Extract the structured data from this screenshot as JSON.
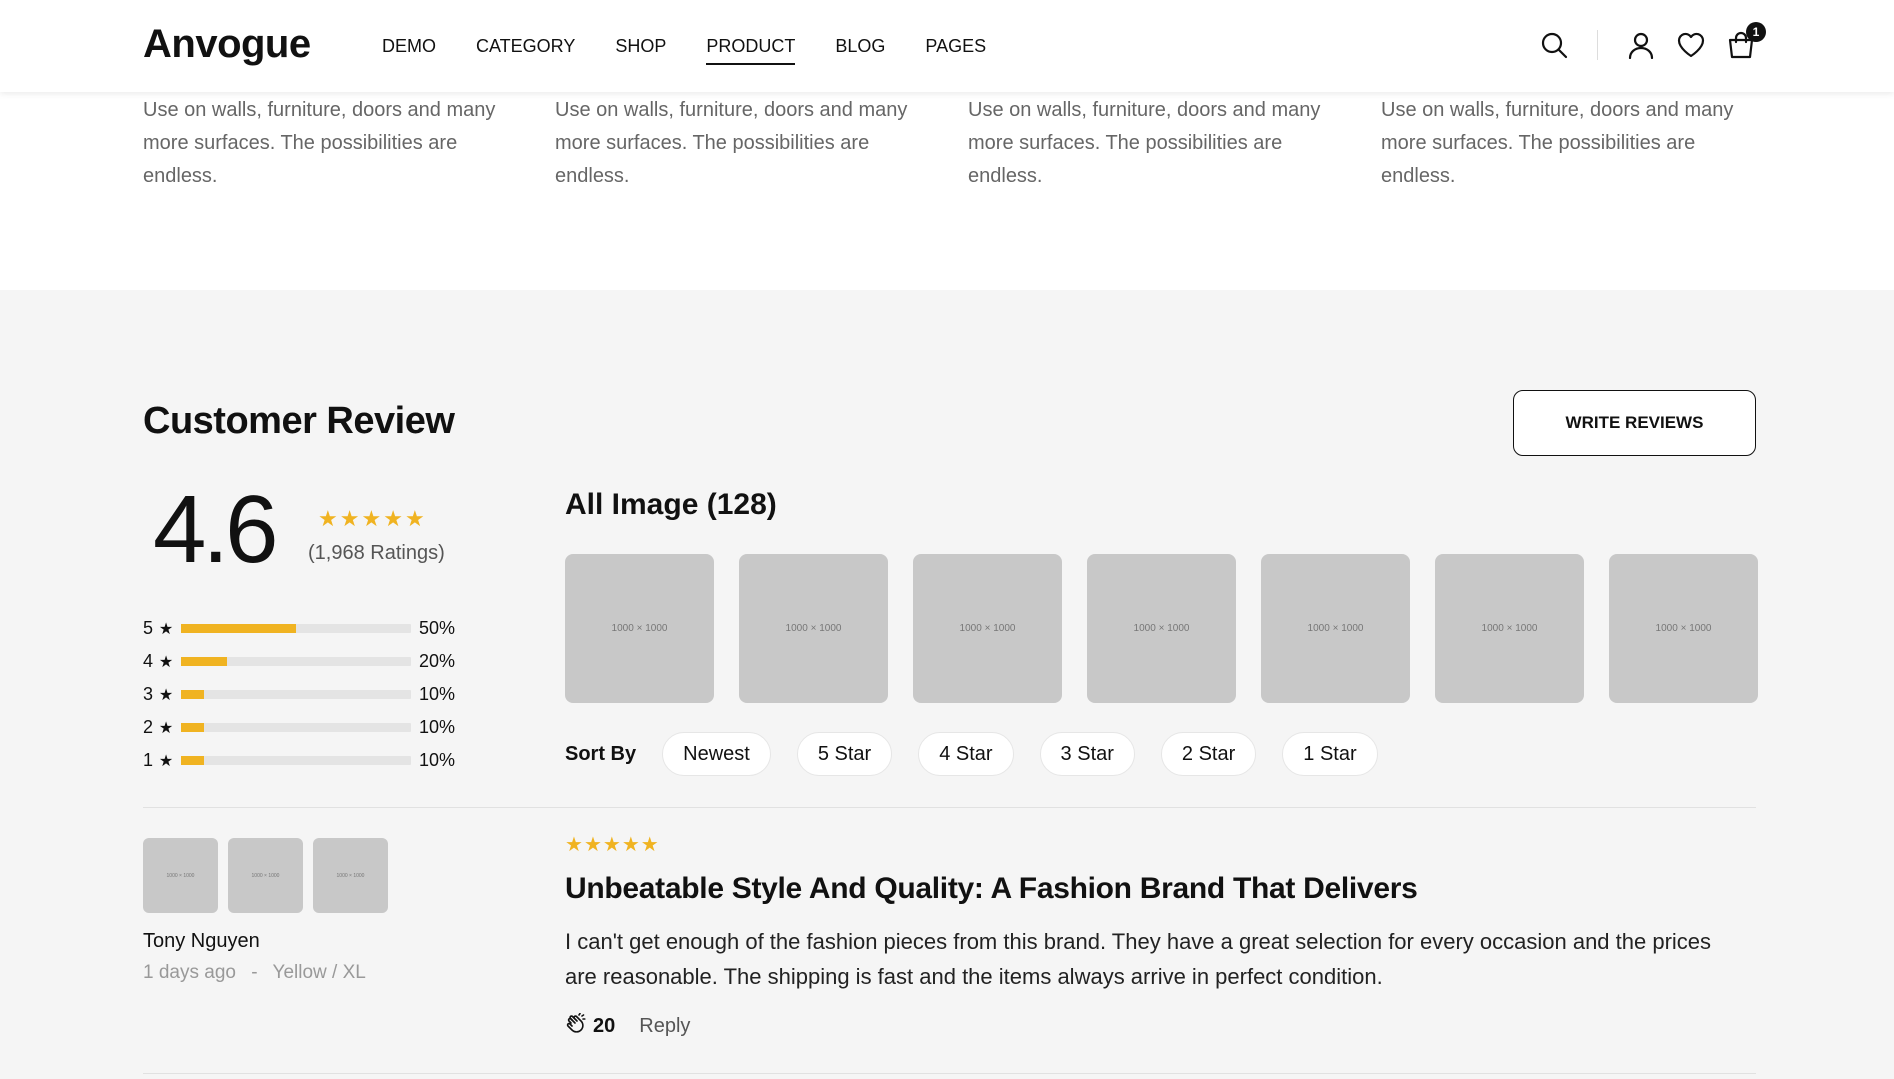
{
  "brand": {
    "logo": "Anvogue"
  },
  "nav": {
    "items": [
      {
        "label": "DEMO"
      },
      {
        "label": "CATEGORY"
      },
      {
        "label": "SHOP"
      },
      {
        "label": "PRODUCT"
      },
      {
        "label": "BLOG"
      },
      {
        "label": "PAGES"
      }
    ],
    "active": "PRODUCT"
  },
  "header_icons": {
    "search": "search-icon",
    "user": "user-icon",
    "wishlist": "heart-icon",
    "cart": "cart-icon",
    "cart_count": "1"
  },
  "features": {
    "descriptions": [
      "Use on walls, furniture, doors and many more surfaces. The possibilities are endless.",
      "Use on walls, furniture, doors and many more surfaces. The possibilities are endless.",
      "Use on walls, furniture, doors and many more surfaces. The possibilities are endless.",
      "Use on walls, furniture, doors and many more surfaces. The possibilities are endless."
    ]
  },
  "reviews": {
    "title": "Customer Review",
    "write_button": "WRITE REVIEWS",
    "average": "4.6",
    "ratings_count": "(1,968 Ratings)",
    "accent_color": "#f0b321",
    "distribution": [
      {
        "stars": "5",
        "percent": 50,
        "label": "50%"
      },
      {
        "stars": "4",
        "percent": 20,
        "label": "20%"
      },
      {
        "stars": "3",
        "percent": 10,
        "label": "10%"
      },
      {
        "stars": "2",
        "percent": 10,
        "label": "10%"
      },
      {
        "stars": "1",
        "percent": 10,
        "label": "10%"
      }
    ],
    "all_images_title": "All Image (128)",
    "image_placeholders": [
      "1000 × 1000",
      "1000 × 1000",
      "1000 × 1000",
      "1000 × 1000",
      "1000 × 1000",
      "1000 × 1000",
      "1000 × 1000"
    ],
    "sort_label": "Sort By",
    "sort_options": [
      "Newest",
      "5 Star",
      "4 Star",
      "3 Star",
      "2 Star",
      "1 Star"
    ],
    "items": [
      {
        "images": [
          "1000 × 1000",
          "1000 × 1000",
          "1000 × 1000"
        ],
        "author": "Tony Nguyen",
        "time": "1 days ago",
        "meta_separator": "-",
        "variant": "Yellow / XL",
        "stars": 5,
        "heading": "Unbeatable Style And Quality: A Fashion Brand That Delivers",
        "body": "I can't get enough of the fashion pieces from this brand. They have a great selection for every occasion and the prices are reasonable. The shipping is fast and the items always arrive in perfect condition.",
        "likes": "20",
        "reply_label": "Reply"
      }
    ]
  }
}
